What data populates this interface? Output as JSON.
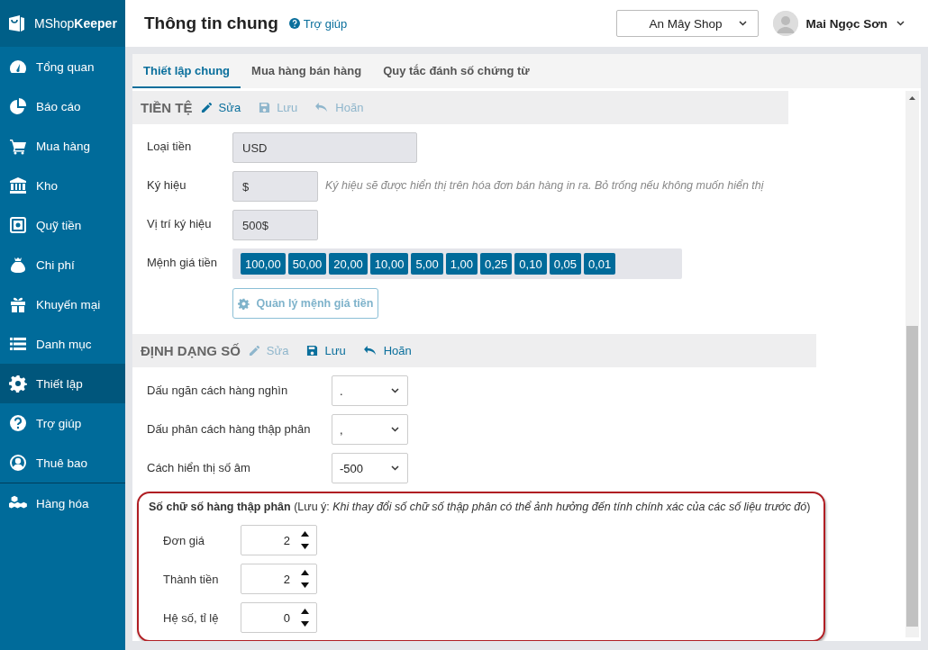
{
  "logo": "MShop**Keeper**",
  "sidebar": {
    "items": [
      {
        "label": "Tổng quan",
        "selected": false,
        "divider_before": false
      },
      {
        "label": "Báo cáo",
        "selected": false,
        "divider_before": false
      },
      {
        "label": "Mua hàng",
        "selected": false,
        "divider_before": false
      },
      {
        "label": "Kho",
        "selected": false,
        "divider_before": false
      },
      {
        "label": "Quỹ tiền",
        "selected": false,
        "divider_before": false
      },
      {
        "label": "Chi phí",
        "selected": false,
        "divider_before": false
      },
      {
        "label": "Khuyến mại",
        "selected": false,
        "divider_before": false
      },
      {
        "label": "Danh mục",
        "selected": false,
        "divider_before": false
      },
      {
        "label": "Thiết lập",
        "selected": true,
        "divider_before": false
      },
      {
        "label": "Trợ giúp",
        "selected": false,
        "divider_before": false
      },
      {
        "label": "Thuê bao",
        "selected": false,
        "divider_before": false
      },
      {
        "label": "Hàng hóa",
        "selected": false,
        "divider_before": true
      }
    ]
  },
  "header": {
    "title": "Thông tin chung",
    "help_link": "Trợ giúp",
    "shop_select": "An Mây Shop",
    "user_name": "Mai Ngọc Sơn"
  },
  "tabs": [
    {
      "label": "Thiết lập chung",
      "selected": true
    },
    {
      "label": "Mua hàng bán hàng",
      "selected": false
    },
    {
      "label": "Quy tắc đánh số chứng từ",
      "selected": false
    }
  ],
  "sections": [
    {
      "title": "TIỀN TỆ",
      "actions": [
        {
          "kind": "edit",
          "label": "Sửa",
          "disabled": false
        },
        {
          "kind": "save",
          "label": "Lưu",
          "disabled": true
        },
        {
          "kind": "undo",
          "label": "Hoãn",
          "disabled": true
        }
      ],
      "rows": [
        {
          "kind": "text",
          "label": "Loại tiền",
          "value": "USD",
          "wide": true
        },
        {
          "kind": "text",
          "label": "Ký hiệu",
          "value": "$",
          "wide": false,
          "hint": "Ký hiệu sẽ được hiển thị trên hóa đơn bán hàng in ra. Bỏ trống nếu không muốn hiển thị"
        },
        {
          "kind": "text",
          "label": "Vị trí ký hiệu",
          "value": "500$",
          "wide": false
        },
        {
          "kind": "chips",
          "label": "Mệnh giá tiền",
          "chips": [
            "100,00",
            "50,00",
            "20,00",
            "10,00",
            "5,00",
            "1,00",
            "0,25",
            "0,10",
            "0,05",
            "0,01"
          ],
          "button": {
            "label": "Quản lý mệnh giá tiền",
            "disabled": true
          }
        }
      ]
    },
    {
      "title": "ĐỊNH DẠNG SỐ",
      "actions": [
        {
          "kind": "edit",
          "label": "Sửa",
          "disabled": true
        },
        {
          "kind": "save",
          "label": "Lưu",
          "disabled": false
        },
        {
          "kind": "undo",
          "label": "Hoãn",
          "disabled": false
        }
      ],
      "rows": [
        {
          "kind": "select",
          "label": "Dấu ngăn cách hàng nghìn",
          "value": "."
        },
        {
          "kind": "select",
          "label": "Dấu phân cách hàng thập phân",
          "value": ","
        },
        {
          "kind": "select",
          "label": "Cách hiển thị số âm",
          "value": "-500"
        },
        {
          "kind": "decimals",
          "note": "**Số chữ số hàng thập phân** (Lưu ý: *Khi thay đổi số chữ số thập phân có thể ảnh hưởng đến tính chính xác của các số liệu trước đó*)",
          "highlighted": true,
          "fields": [
            {
              "label": "Đơn giá",
              "value": "2"
            },
            {
              "label": "Thành tiền",
              "value": "2"
            },
            {
              "label": "Hệ số, tỉ lệ",
              "value": "0"
            }
          ]
        }
      ]
    }
  ]
}
